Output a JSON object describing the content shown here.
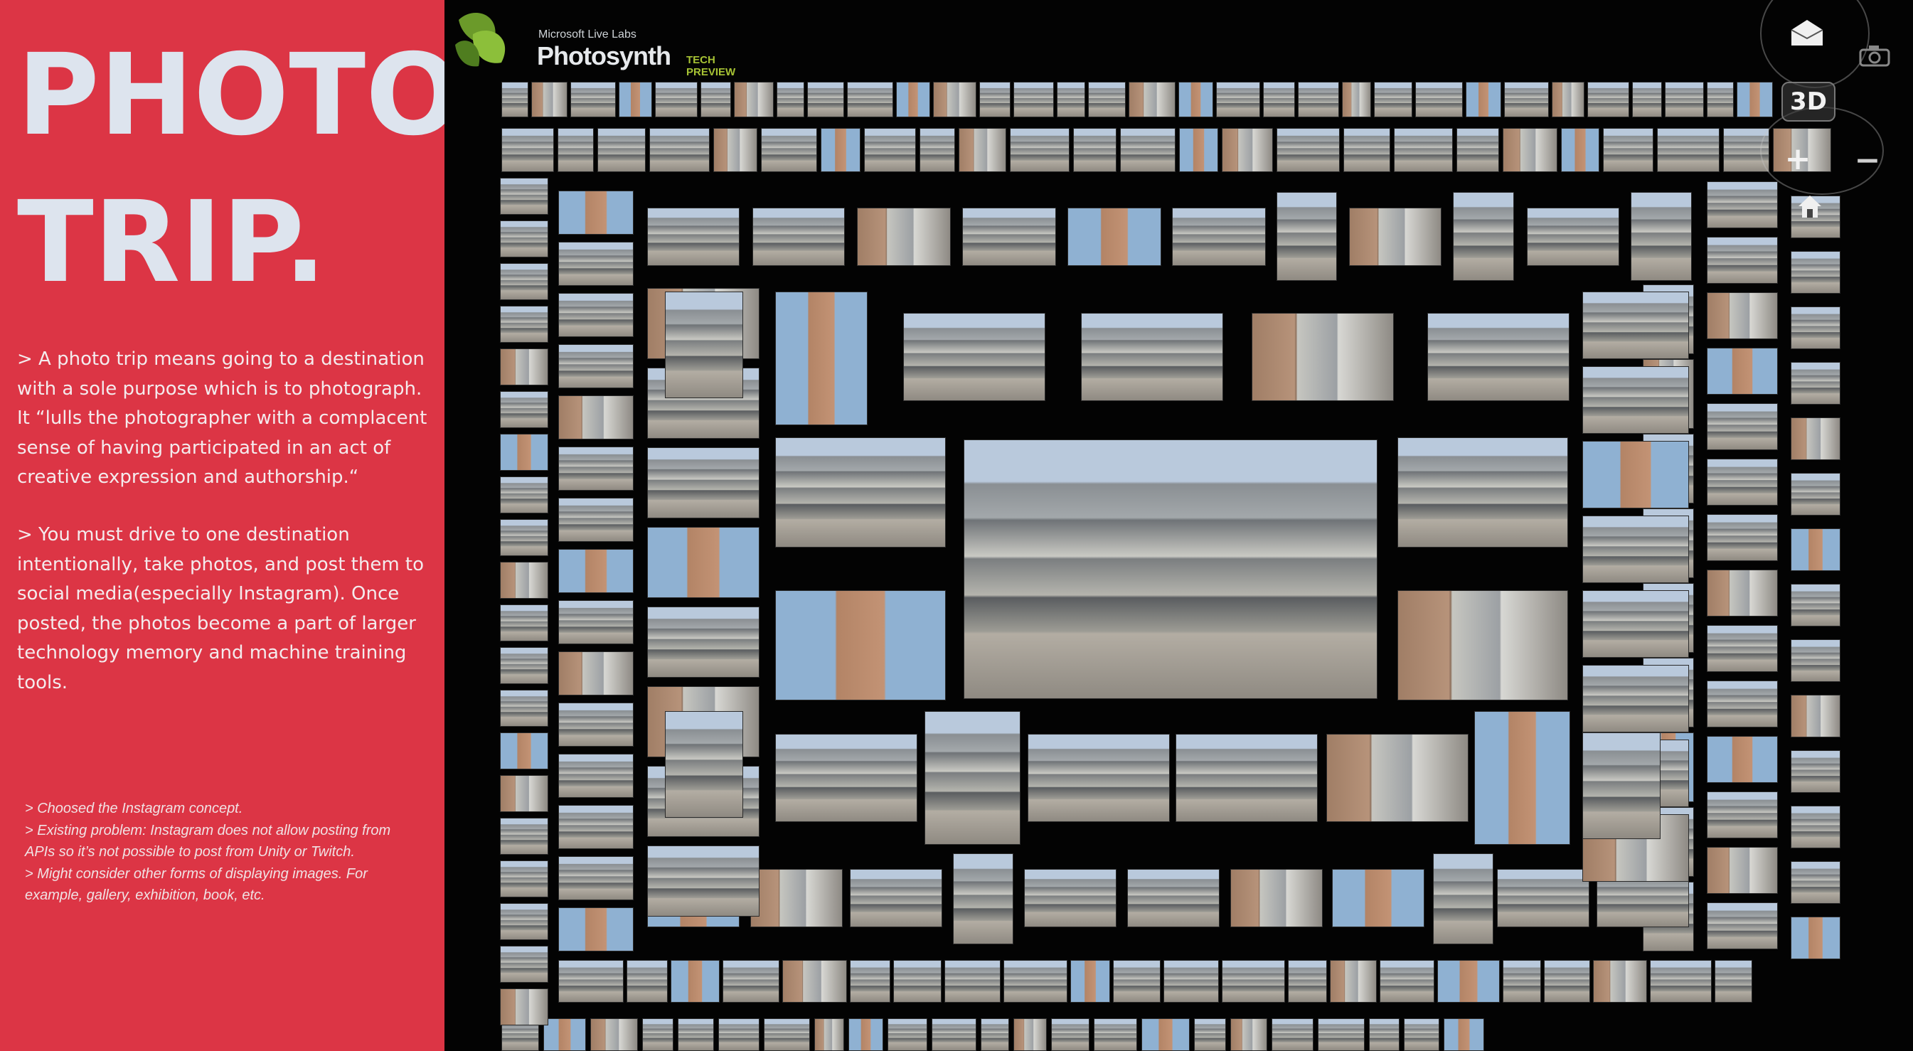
{
  "slide": {
    "title_line_1": "PHOTO",
    "title_line_2": "TRIP.",
    "paragraph_1": "> A photo trip means going to a destination with a sole purpose which is to photograph. It “lulls the photographer with a complacent sense of having participated in an act of creative expression and authorship.“",
    "paragraph_2": "> You must drive to one destination intentionally, take photos, and post them to social media(especially Instagram). Once posted, the photos become a part of larger technology memory and machine training tools.",
    "notes": [
      "> Choosed the Instagram concept.",
      "> Existing problem: Instagram does not allow posting from APIs so it’s not possible to post from Unity or Twitch.",
      "> Might consider other forms of displaying images. For example, gallery, exhibition, book, etc."
    ],
    "panel_color": "#dc3545",
    "title_color": "#dde4ee"
  },
  "photosynth": {
    "logo_small": "Microsoft Live Labs",
    "logo_main": "Photosynth",
    "logo_tag": "TECH PREVIEW",
    "controls": {
      "view_3d_label": "3D",
      "zoom_in_label": "+",
      "zoom_out_label": "−",
      "home_icon": "home-icon",
      "mail_icon": "mail-icon",
      "camera_icon": "camera-icon"
    },
    "background_color": "#030303",
    "logo_accent_color": "#a6c234"
  }
}
